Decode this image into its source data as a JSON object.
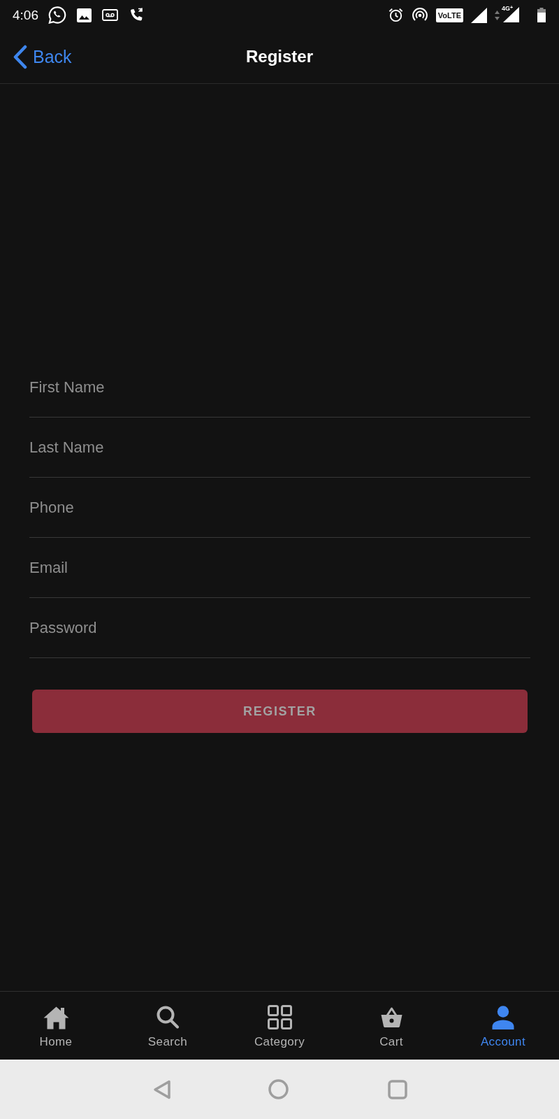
{
  "status_bar": {
    "time": "4:06",
    "volte_badge": "VoLTE",
    "network_type": "4G$^{+}$"
  },
  "header": {
    "back_label": "Back",
    "title": "Register"
  },
  "form": {
    "fields": [
      {
        "placeholder": "First Name"
      },
      {
        "placeholder": "Last Name"
      },
      {
        "placeholder": "Phone"
      },
      {
        "placeholder": "Email"
      },
      {
        "placeholder": "Password"
      }
    ]
  },
  "register_button": {
    "label": "REGISTER",
    "disabled": true
  },
  "bottom_nav": {
    "tabs": [
      {
        "label": "Home",
        "selected": false
      },
      {
        "label": "Search",
        "selected": false
      },
      {
        "label": "Category",
        "selected": false
      },
      {
        "label": "Cart",
        "selected": false
      },
      {
        "label": "Account",
        "selected": true
      }
    ]
  }
}
